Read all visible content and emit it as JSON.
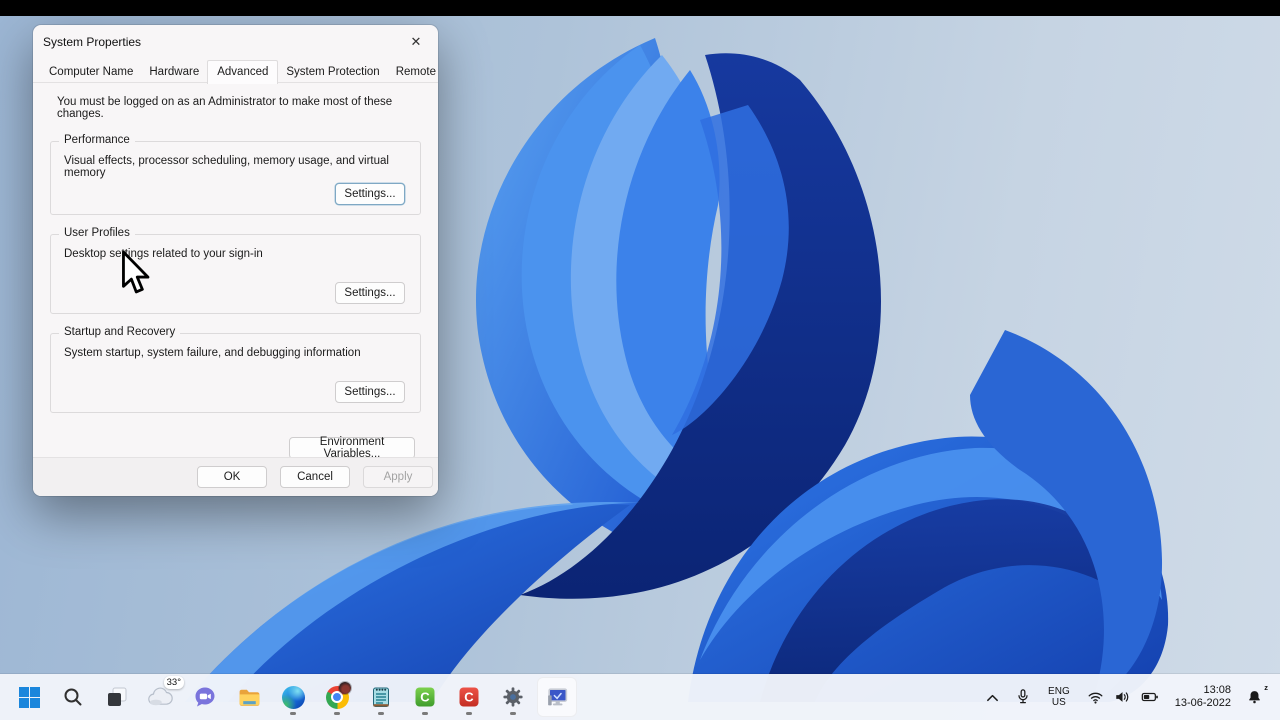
{
  "dialog": {
    "title": "System Properties",
    "close_glyph": "✕",
    "tabs": [
      "Computer Name",
      "Hardware",
      "Advanced",
      "System Protection",
      "Remote"
    ],
    "selected_tab": "Advanced",
    "admin_note": "You must be logged on as an Administrator to make most of these changes.",
    "sections": [
      {
        "title": "Performance",
        "desc": "Visual effects, processor scheduling, memory usage, and virtual memory",
        "button": "Settings..."
      },
      {
        "title": "User Profiles",
        "desc": "Desktop settings related to your sign-in",
        "button": "Settings..."
      },
      {
        "title": "Startup and Recovery",
        "desc": "System startup, system failure, and debugging information",
        "button": "Settings..."
      }
    ],
    "env_vars_button": "Environment Variables...",
    "buttons": {
      "ok": "OK",
      "cancel": "Cancel",
      "apply": "Apply"
    }
  },
  "taskbar": {
    "weather": {
      "temp": "33°"
    },
    "icons": [
      "start",
      "search",
      "task-view",
      "weather",
      "chat",
      "file-explorer",
      "edge",
      "chrome",
      "notepad",
      "camtasia-green",
      "camtasia-red",
      "settings",
      "system-properties"
    ],
    "running_icons": [
      "edge",
      "chrome",
      "notepad",
      "camtasia-green",
      "camtasia-red",
      "settings"
    ],
    "tray": {
      "language_line1": "ENG",
      "language_line2": "US",
      "time": "13:08",
      "date": "13-06-2022",
      "focus_z": "z"
    }
  },
  "colors": {
    "accent": "#0a59b8",
    "taskbar_bg": "#f1f4fa",
    "desktop_top": "#9cb6d4",
    "desktop_bottom": "#cfdbe8",
    "bloom_bright": "#4b93ee",
    "bloom_dark": "#0b2474",
    "dialog_bg": "#f8f6f7"
  }
}
